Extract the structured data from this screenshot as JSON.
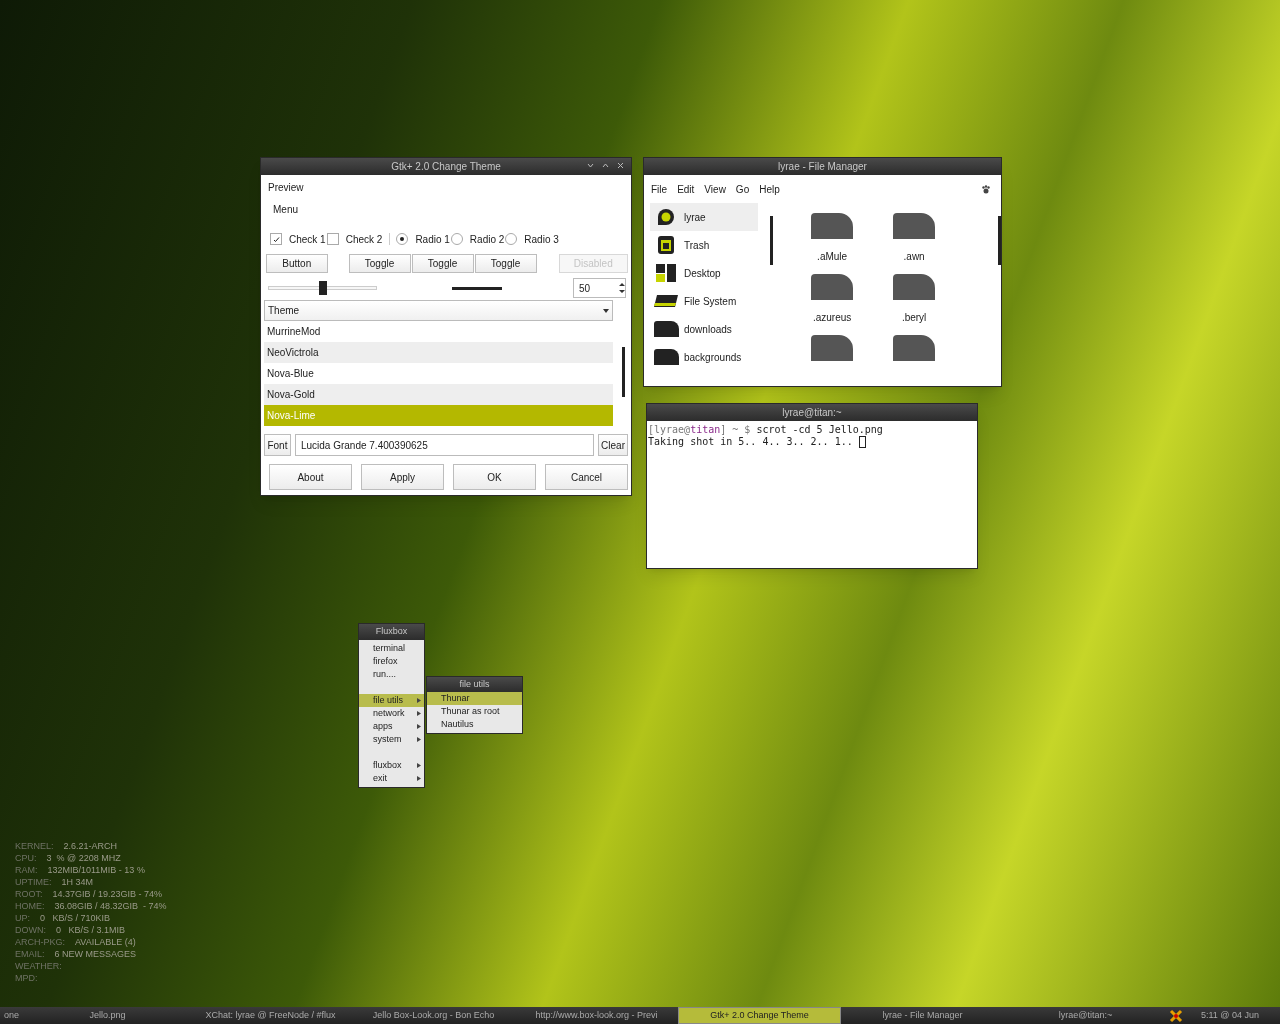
{
  "theme_window": {
    "title": "Gtk+ 2.0 Change Theme",
    "preview_label": "Preview",
    "menu": "Menu",
    "checks": [
      {
        "label": "Check 1",
        "checked": true
      },
      {
        "label": "Check 2",
        "checked": false
      }
    ],
    "radios": [
      {
        "label": "Radio 1",
        "selected": true
      },
      {
        "label": "Radio 2",
        "selected": false
      },
      {
        "label": "Radio 3",
        "selected": false
      }
    ],
    "button": "Button",
    "toggles": [
      "Toggle",
      "Toggle",
      "Toggle"
    ],
    "disabled_button": "Disabled",
    "slider": {
      "level": 0.5
    },
    "spin": {
      "value": "50"
    },
    "combo": "Theme",
    "themes": [
      {
        "name": "MurrineMod",
        "selected": false
      },
      {
        "name": "NeoVictrola",
        "selected": false
      },
      {
        "name": "Nova-Blue",
        "selected": false
      },
      {
        "name": "Nova-Gold",
        "selected": false
      },
      {
        "name": "Nova-Lime",
        "selected": true
      }
    ],
    "font_button": "Font",
    "font_value": "Lucida Grande 7.400390625",
    "clear_button": "Clear",
    "dialog_buttons": [
      "About",
      "Apply",
      "OK",
      "Cancel"
    ]
  },
  "file_manager": {
    "title": "lyrae - File Manager",
    "menu": [
      "File",
      "Edit",
      "View",
      "Go",
      "Help"
    ],
    "places": [
      {
        "name": "lyrae",
        "kind": "home",
        "selected": true
      },
      {
        "name": "Trash",
        "kind": "trash",
        "selected": false
      },
      {
        "name": "Desktop",
        "kind": "desktop",
        "selected": false
      },
      {
        "name": "File System",
        "kind": "drive",
        "selected": false
      },
      {
        "name": "downloads",
        "kind": "folder",
        "selected": false
      },
      {
        "name": "backgrounds",
        "kind": "folder",
        "selected": false
      }
    ],
    "files": [
      ".aMule",
      ".awn",
      ".azureus",
      ".beryl"
    ]
  },
  "terminal": {
    "title": "lyrae@titan:~",
    "prompt": {
      "open": "[lyrae@",
      "host": "titan",
      "close": "] ~ $",
      "command": "scrot -cd 5 Jello.png"
    },
    "output": "Taking shot in 5.. 4.. 3.. 2.. 1.."
  },
  "fluxbox_menu": {
    "title": "Fluxbox",
    "items": [
      {
        "label": "terminal",
        "kind": "item",
        "submenu": false,
        "selected": false
      },
      {
        "label": "firefox",
        "kind": "item",
        "submenu": false,
        "selected": false
      },
      {
        "label": "run....",
        "kind": "item",
        "submenu": false,
        "selected": false
      },
      {
        "kind": "separator"
      },
      {
        "label": "file utils",
        "kind": "item",
        "submenu": true,
        "selected": true
      },
      {
        "label": "network",
        "kind": "item",
        "submenu": true,
        "selected": false
      },
      {
        "label": "apps",
        "kind": "item",
        "submenu": true,
        "selected": false
      },
      {
        "label": "system",
        "kind": "item",
        "submenu": true,
        "selected": false
      },
      {
        "kind": "separator"
      },
      {
        "label": "fluxbox",
        "kind": "item",
        "submenu": true,
        "selected": false
      },
      {
        "label": "exit",
        "kind": "item",
        "submenu": true,
        "selected": false
      }
    ],
    "submenu": {
      "title": "file utils",
      "items": [
        {
          "label": "Thunar",
          "selected": true
        },
        {
          "label": "Thunar as root",
          "selected": false
        },
        {
          "label": "Nautilus",
          "selected": false
        }
      ]
    }
  },
  "conky": [
    {
      "label": "KERNEL:",
      "value": "2.6.21-ARCH"
    },
    {
      "label": "CPU:",
      "value": "3  % @ 2208 MHZ"
    },
    {
      "label": "RAM:",
      "value": "132MIB/1011MIB - 13 %"
    },
    {
      "label": "UPTIME:",
      "value": "1H 34M"
    },
    {
      "label": "ROOT:",
      "value": "14.37GIB / 19.23GIB - 74%"
    },
    {
      "label": "HOME:",
      "value": "36.08GIB / 48.32GIB  - 74%"
    },
    {
      "label": "UP:",
      "value": "0   KB/S / 710KIB"
    },
    {
      "label": "DOWN:",
      "value": "0   KB/S / 3.1MIB"
    },
    {
      "label": "ARCH-PKG:",
      "value": "AVAILABLE (4)"
    },
    {
      "label": "EMAIL:",
      "value": "6 NEW MESSAGES"
    },
    {
      "label": "WEATHER:"
    },
    {
      "label": "MPD:"
    }
  ],
  "taskbar": {
    "workspace": "one",
    "tasks": [
      {
        "label": "Jello.png",
        "selected": false
      },
      {
        "label": "XChat: lyrae @ FreeNode / #flux",
        "selected": false
      },
      {
        "label": "Jello Box-Look.org - Bon Echo",
        "selected": false
      },
      {
        "label": "http://www.box-look.org - Previ",
        "selected": false
      },
      {
        "label": "Gtk+ 2.0 Change Theme",
        "selected": true
      },
      {
        "label": "lyrae - File Manager",
        "selected": false
      },
      {
        "label": "lyrae@titan:~",
        "selected": false
      }
    ],
    "clock": "5:11 @ 04 Jun"
  }
}
